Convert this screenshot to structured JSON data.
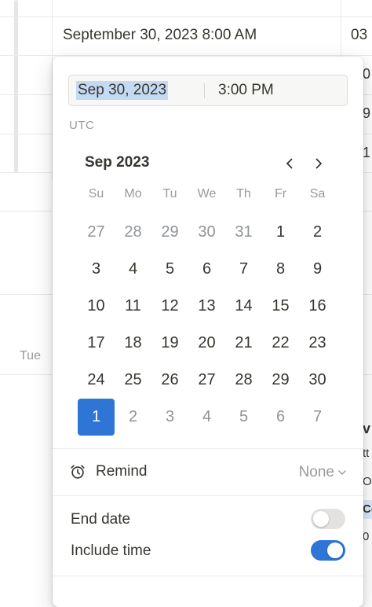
{
  "background": {
    "cell_date": "September 30, 2023 8:00 AM",
    "cell_right": "03",
    "right_glyphs": [
      "0",
      "9",
      "1"
    ],
    "weekday_label": "Tue",
    "right_side_glyphs": [
      "v",
      "tt",
      "Ol",
      "Co",
      "0"
    ]
  },
  "picker": {
    "date_value": "Sep 30, 2023",
    "time_value": "3:00 PM",
    "timezone": "UTC",
    "month_label": "Sep 2023",
    "prev_icon": "chevron-left-icon",
    "next_icon": "chevron-right-icon",
    "weekdays": [
      "Su",
      "Mo",
      "Tu",
      "We",
      "Th",
      "Fr",
      "Sa"
    ],
    "days": [
      {
        "n": "27",
        "muted": true
      },
      {
        "n": "28",
        "muted": true
      },
      {
        "n": "29",
        "muted": true
      },
      {
        "n": "30",
        "muted": true
      },
      {
        "n": "31",
        "muted": true
      },
      {
        "n": "1"
      },
      {
        "n": "2"
      },
      {
        "n": "3"
      },
      {
        "n": "4"
      },
      {
        "n": "5"
      },
      {
        "n": "6"
      },
      {
        "n": "7"
      },
      {
        "n": "8"
      },
      {
        "n": "9"
      },
      {
        "n": "10"
      },
      {
        "n": "11"
      },
      {
        "n": "12"
      },
      {
        "n": "13"
      },
      {
        "n": "14"
      },
      {
        "n": "15"
      },
      {
        "n": "16"
      },
      {
        "n": "17"
      },
      {
        "n": "18"
      },
      {
        "n": "19"
      },
      {
        "n": "20"
      },
      {
        "n": "21"
      },
      {
        "n": "22"
      },
      {
        "n": "23"
      },
      {
        "n": "24"
      },
      {
        "n": "25"
      },
      {
        "n": "26"
      },
      {
        "n": "27"
      },
      {
        "n": "28"
      },
      {
        "n": "29"
      },
      {
        "n": "30"
      },
      {
        "n": "1",
        "muted": true,
        "selected": true
      },
      {
        "n": "2",
        "muted": true
      },
      {
        "n": "3",
        "muted": true
      },
      {
        "n": "4",
        "muted": true
      },
      {
        "n": "5",
        "muted": true
      },
      {
        "n": "6",
        "muted": true
      },
      {
        "n": "7",
        "muted": true
      }
    ],
    "remind": {
      "label": "Remind",
      "value": "None",
      "icon": "alarm-clock-icon"
    },
    "end_date": {
      "label": "End date",
      "on": false
    },
    "include_time": {
      "label": "Include time",
      "on": true
    },
    "accent": "#2e75d6"
  }
}
